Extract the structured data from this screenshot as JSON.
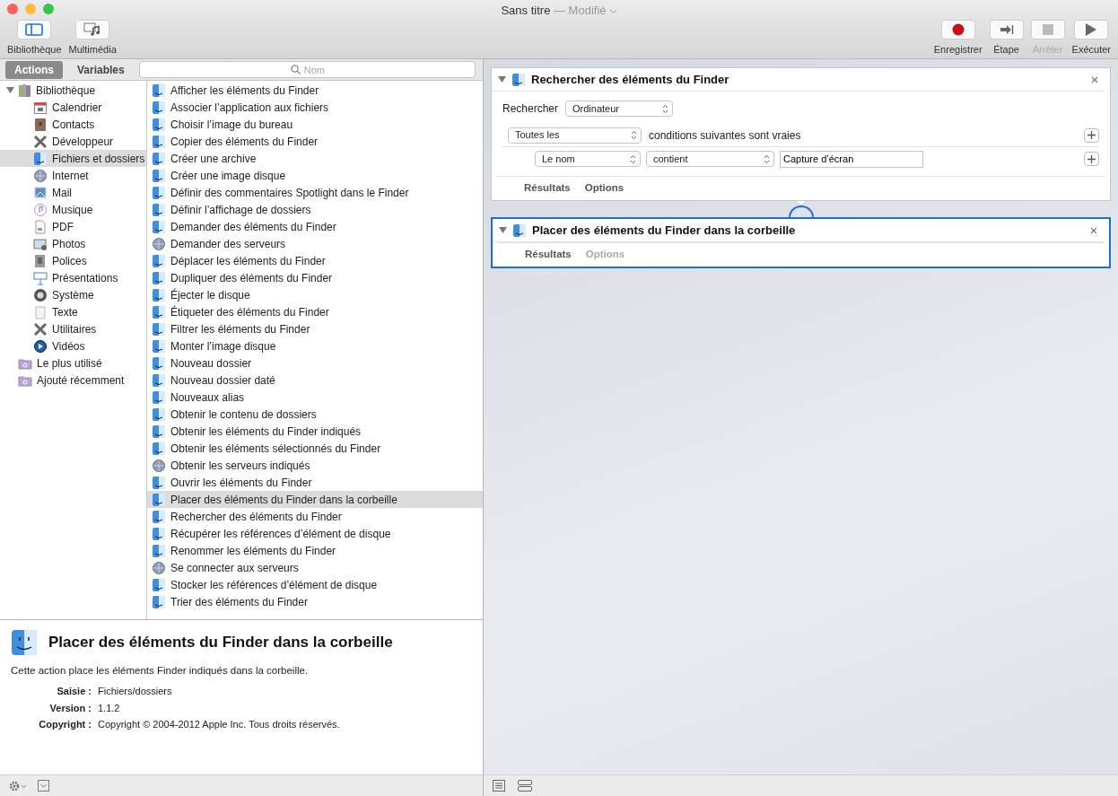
{
  "window": {
    "title": "Sans titre",
    "subtitle": "— Modifié"
  },
  "toolbar": {
    "left": [
      {
        "label": "Bibliothèque"
      },
      {
        "label": "Multimédia"
      }
    ],
    "right": [
      {
        "label": "Enregistrer",
        "disabled": false
      },
      {
        "label": "Étape",
        "disabled": false
      },
      {
        "label": "Arrêter",
        "disabled": true
      },
      {
        "label": "Exécuter",
        "disabled": false
      }
    ]
  },
  "library_tabs": [
    {
      "label": "Actions",
      "selected": true
    },
    {
      "label": "Variables",
      "selected": false
    }
  ],
  "search": {
    "placeholder": "Nom"
  },
  "library_tree": [
    {
      "label": "Bibliothèque",
      "expanded": true,
      "selected": false,
      "children": [
        {
          "label": "Calendrier",
          "selected": false
        },
        {
          "label": "Contacts",
          "selected": false
        },
        {
          "label": "Développeur",
          "selected": false
        },
        {
          "label": "Fichiers et dossiers",
          "selected": true
        },
        {
          "label": "Internet",
          "selected": false
        },
        {
          "label": "Mail",
          "selected": false
        },
        {
          "label": "Musique",
          "selected": false
        },
        {
          "label": "PDF",
          "selected": false
        },
        {
          "label": "Photos",
          "selected": false
        },
        {
          "label": "Polices",
          "selected": false
        },
        {
          "label": "Présentations",
          "selected": false
        },
        {
          "label": "Système",
          "selected": false
        },
        {
          "label": "Texte",
          "selected": false
        },
        {
          "label": "Utilitaires",
          "selected": false
        },
        {
          "label": "Vidéos",
          "selected": false
        }
      ]
    },
    {
      "label": "Le plus utilisé",
      "selected": false
    },
    {
      "label": "Ajouté récemment",
      "selected": false
    }
  ],
  "actions": [
    {
      "label": "Afficher les éléments du Finder",
      "kind": "finder",
      "selected": false
    },
    {
      "label": "Associer l’application aux fichiers",
      "kind": "finder",
      "selected": false
    },
    {
      "label": "Choisir l’image du bureau",
      "kind": "finder",
      "selected": false
    },
    {
      "label": "Copier des éléments du Finder",
      "kind": "finder",
      "selected": false
    },
    {
      "label": "Créer une archive",
      "kind": "finder",
      "selected": false
    },
    {
      "label": "Créer une image disque",
      "kind": "finder",
      "selected": false
    },
    {
      "label": "Définir des commentaires Spotlight dans le Finder",
      "kind": "finder",
      "selected": false
    },
    {
      "label": "Définir l’affichage de dossiers",
      "kind": "finder",
      "selected": false
    },
    {
      "label": "Demander des éléments du Finder",
      "kind": "finder",
      "selected": false
    },
    {
      "label": "Demander des serveurs",
      "kind": "server",
      "selected": false
    },
    {
      "label": "Déplacer les éléments du Finder",
      "kind": "finder",
      "selected": false
    },
    {
      "label": "Dupliquer des éléments du Finder",
      "kind": "finder",
      "selected": false
    },
    {
      "label": "Éjecter le disque",
      "kind": "finder",
      "selected": false
    },
    {
      "label": "Étiqueter des éléments du Finder",
      "kind": "finder",
      "selected": false
    },
    {
      "label": "Filtrer les éléments du Finder",
      "kind": "finder",
      "selected": false
    },
    {
      "label": "Monter l’image disque",
      "kind": "finder",
      "selected": false
    },
    {
      "label": "Nouveau dossier",
      "kind": "finder",
      "selected": false
    },
    {
      "label": "Nouveau dossier daté",
      "kind": "finder",
      "selected": false
    },
    {
      "label": "Nouveaux alias",
      "kind": "finder",
      "selected": false
    },
    {
      "label": "Obtenir le contenu de dossiers",
      "kind": "finder",
      "selected": false
    },
    {
      "label": "Obtenir les éléments du Finder indiqués",
      "kind": "finder",
      "selected": false
    },
    {
      "label": "Obtenir les éléments sélectionnés du Finder",
      "kind": "finder",
      "selected": false
    },
    {
      "label": "Obtenir les serveurs indiqués",
      "kind": "server",
      "selected": false
    },
    {
      "label": "Ouvrir les éléments du Finder",
      "kind": "finder",
      "selected": false
    },
    {
      "label": "Placer des éléments du Finder dans la corbeille",
      "kind": "finder",
      "selected": true
    },
    {
      "label": "Rechercher des éléments du Finder",
      "kind": "finder",
      "selected": false
    },
    {
      "label": "Récupérer les références d’élément de disque",
      "kind": "finder",
      "selected": false
    },
    {
      "label": "Renommer les éléments du Finder",
      "kind": "finder",
      "selected": false
    },
    {
      "label": "Se connecter aux serveurs",
      "kind": "server",
      "selected": false
    },
    {
      "label": "Stocker les références d’élément de disque",
      "kind": "finder",
      "selected": false
    },
    {
      "label": "Trier des éléments du Finder",
      "kind": "finder",
      "selected": false
    }
  ],
  "description": {
    "title": "Placer des éléments du Finder dans la corbeille",
    "text": "Cette action place les éléments Finder indiqués dans la corbeille.",
    "fields": [
      {
        "label": "Saisie :",
        "value": "Fichiers/dossiers"
      },
      {
        "label": "Version :",
        "value": "1.1.2"
      },
      {
        "label": "Copyright :",
        "value": "Copyright © 2004-2012 Apple Inc. Tous droits réservés."
      }
    ]
  },
  "workflow": [
    {
      "title": "Rechercher des éléments du Finder",
      "expanded": true,
      "selected": false,
      "search_in": {
        "label": "Rechercher",
        "value": "Ordinateur"
      },
      "match": {
        "value": "Toutes les",
        "text": "conditions suivantes sont vraies"
      },
      "criteria": [
        {
          "field": "Le nom",
          "operator": "contient",
          "value": "Capture d’écran"
        }
      ],
      "tabs": [
        {
          "label": "Résultats",
          "disabled": false
        },
        {
          "label": "Options",
          "disabled": false
        }
      ]
    },
    {
      "title": "Placer des éléments du Finder dans la corbeille",
      "expanded": true,
      "selected": true,
      "tabs": [
        {
          "label": "Résultats",
          "disabled": false
        },
        {
          "label": "Options",
          "disabled": true
        }
      ]
    }
  ]
}
